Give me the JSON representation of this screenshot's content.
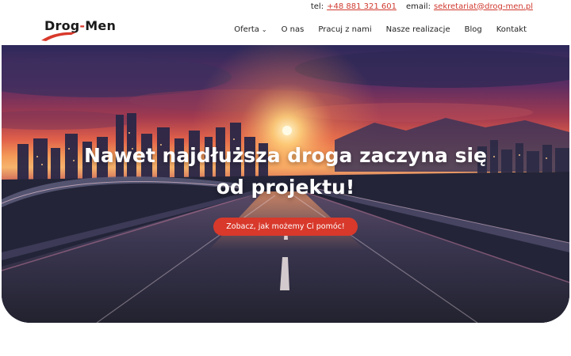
{
  "topbar": {
    "phone_label": "tel:",
    "phone_value": "+48 881 321 601",
    "email_label": "email:",
    "email_value": "sekretariat@drog-men.pl"
  },
  "logo": {
    "text": "Drog-Men",
    "accent_color": "#d8392b"
  },
  "nav": {
    "items": [
      {
        "label": "Oferta",
        "has_dropdown": true
      },
      {
        "label": "O nas"
      },
      {
        "label": "Pracuj z nami"
      },
      {
        "label": "Nasze realizacje"
      },
      {
        "label": "Blog"
      },
      {
        "label": "Kontakt"
      }
    ],
    "dropdown_icon": "chevron-down-icon"
  },
  "hero": {
    "title_line1": "Nawet najdłuższa droga zaczyna się",
    "title_line2": "od projektu!",
    "cta_label": "Zobacz, jak możemy Ci pomóc!",
    "cta_color": "#d8392b"
  }
}
